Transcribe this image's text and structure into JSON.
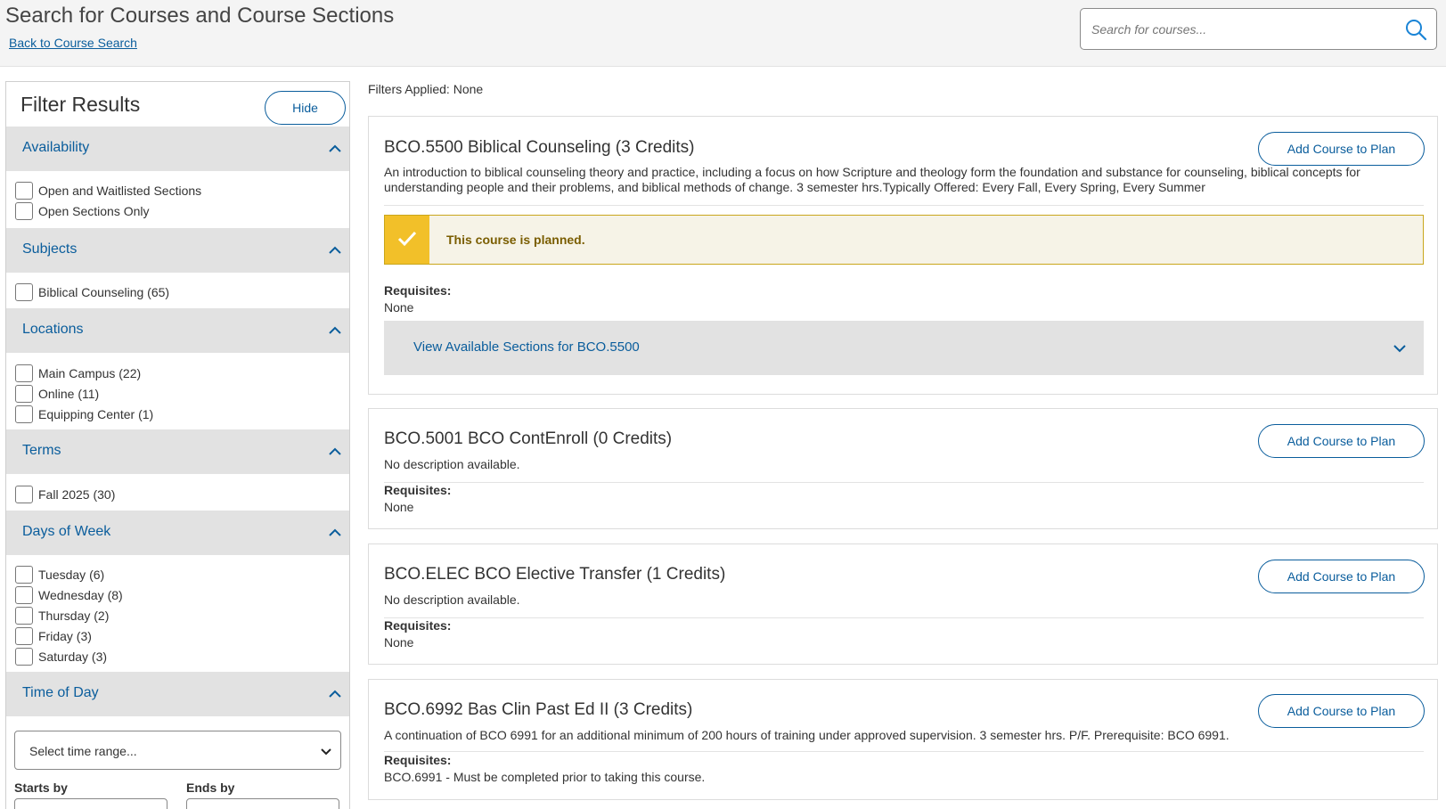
{
  "header": {
    "title": "Search for Courses and Course Sections",
    "back_link": "Back to Course Search",
    "search_placeholder": "Search for courses..."
  },
  "sidebar": {
    "title": "Filter Results",
    "hide_label": "Hide",
    "facets": [
      {
        "label": "Availability",
        "options": [
          "Open and Waitlisted Sections",
          "Open Sections Only"
        ]
      },
      {
        "label": "Subjects",
        "options": [
          "Biblical Counseling (65)"
        ]
      },
      {
        "label": "Locations",
        "options": [
          "Main Campus (22)",
          "Online (11)",
          "Equipping Center (1)"
        ]
      },
      {
        "label": "Terms",
        "options": [
          "Fall 2025 (30)"
        ]
      },
      {
        "label": "Days of Week",
        "options": [
          "Tuesday (6)",
          "Wednesday (8)",
          "Thursday (2)",
          "Friday (3)",
          "Saturday (3)"
        ]
      },
      {
        "label": "Time of Day",
        "options": []
      }
    ],
    "time_select": "Select time range...",
    "starts_by": "Starts by",
    "ends_by": "Ends by"
  },
  "main": {
    "filters_applied": "Filters Applied: None",
    "add_label": "Add Course to Plan",
    "requisites_label": "Requisites:",
    "courses": [
      {
        "title": "BCO.5500 Biblical Counseling (3 Credits)",
        "description": "An introduction to biblical counseling theory and practice, including a focus on how Scripture and theology form the foundation and substance for counseling, biblical concepts for understanding people and their problems, and biblical methods of change. 3 semester hrs.Typically Offered: Every Fall, Every Spring, Every Summer",
        "planned": "This course is planned.",
        "requisites": "None",
        "sections_link": "View Available Sections for BCO.5500"
      },
      {
        "title": "BCO.5001 BCO ContEnroll (0 Credits)",
        "description": "No description available.",
        "requisites": "None"
      },
      {
        "title": "BCO.ELEC BCO Elective Transfer (1 Credits)",
        "description": "No description available.",
        "requisites": "None"
      },
      {
        "title": "BCO.6992 Bas Clin Past Ed II (3 Credits)",
        "description": "A continuation of BCO 6991 for an additional minimum of 200 hours of training under approved supervision. 3 semester hrs. P/F. Prerequisite: BCO 6991.",
        "requisites": "BCO.6991 - Must be completed prior to taking this course."
      }
    ]
  },
  "colors": {
    "accent": "#0a5d9c",
    "planned_mark": "#f2c029",
    "planned_bg": "#f6f3e7",
    "facet_bg": "#e2e2e2"
  },
  "icons": [
    "search-icon",
    "chevron-up-icon",
    "chevron-down-icon",
    "checkmark-icon"
  ]
}
